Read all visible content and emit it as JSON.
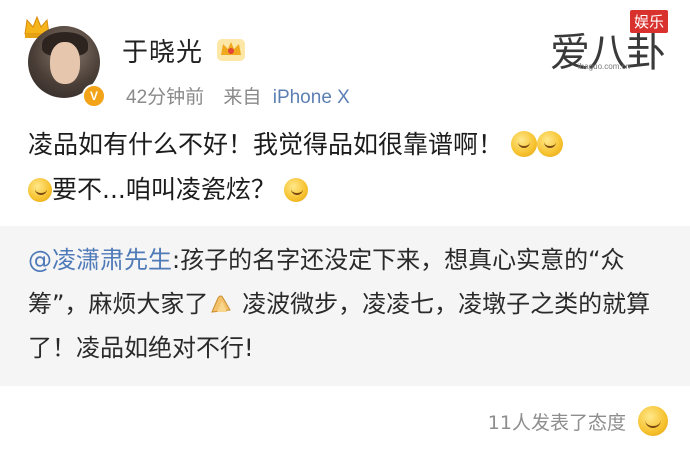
{
  "post": {
    "author": "于晓光",
    "author_badge": "crown-icon",
    "time": "42分钟前",
    "source_label": "来自",
    "device": "iPhone X",
    "text_line1": "凌品如有什么不好！我觉得品如很靠谱啊！",
    "text_line2": "要不...咱叫凌瓷炫？"
  },
  "quote": {
    "mention": "@凌潇肃先生",
    "text_part1": ":孩子的名字还没定下来，想真心实意的“众筹”，麻烦大家了",
    "text_part2": "凌波微步，凌凌七，凌墩子之类的就算了！凌品如绝对不行!"
  },
  "footer": {
    "reactions": "11人发表了态度"
  },
  "watermark": {
    "logo": "爱八卦",
    "tag": "娱乐",
    "url": "ibaguo.com.cn"
  },
  "colors": {
    "link": "#4f7ab8",
    "meta": "#8a8a8a",
    "quote_bg": "#f5f5f5",
    "badge": "#f2a317"
  }
}
